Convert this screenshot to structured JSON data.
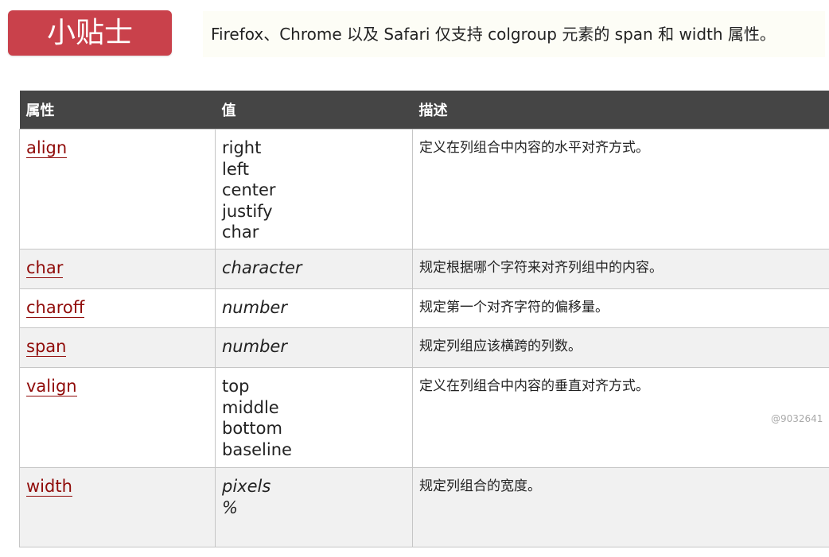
{
  "tip": {
    "badge": "小贴士",
    "note": "Firefox、Chrome 以及 Safari 仅支持 colgroup 元素的 span 和 width 属性。"
  },
  "table": {
    "headers": [
      "属性",
      "值",
      "描述"
    ],
    "rows": [
      {
        "attribute": "align",
        "values": [
          "right",
          "left",
          "center",
          "justify",
          "char"
        ],
        "italic": false,
        "description": "定义在列组合中内容的水平对齐方式。"
      },
      {
        "attribute": "char",
        "values": [
          "character"
        ],
        "italic": true,
        "description": "规定根据哪个字符来对齐列组中的内容。"
      },
      {
        "attribute": "charoff",
        "values": [
          "number"
        ],
        "italic": true,
        "description": "规定第一个对齐字符的偏移量。"
      },
      {
        "attribute": "span",
        "values": [
          "number"
        ],
        "italic": true,
        "description": "规定列组应该横跨的列数。"
      },
      {
        "attribute": "valign",
        "values": [
          "top",
          "middle",
          "bottom",
          "baseline"
        ],
        "italic": false,
        "description": "定义在列组合中内容的垂直对齐方式。"
      },
      {
        "attribute": "width",
        "values": [
          "pixels",
          "%"
        ],
        "italic": true,
        "description": "规定列组合的宽度。"
      }
    ]
  },
  "watermark": "@9032641",
  "colors": {
    "badge": "#c9414b",
    "header": "#454545",
    "link": "#900b09",
    "row_alt": "#f1f1f1"
  }
}
